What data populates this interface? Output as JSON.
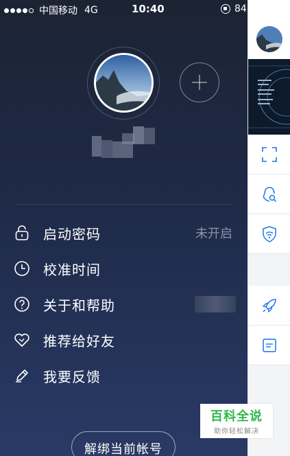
{
  "status_bar": {
    "carrier": "中国移动",
    "network": "4G",
    "time": "10:40",
    "battery": "84",
    "signal_dots": 5,
    "signal_filled": 4
  },
  "profile": {
    "add_account_icon": "plus-icon"
  },
  "menu": {
    "items": [
      {
        "label": "启动密码",
        "value": "未开启",
        "icon": "lock-icon"
      },
      {
        "label": "校准时间",
        "icon": "clock-icon"
      },
      {
        "label": "关于和帮助",
        "icon": "question-icon"
      },
      {
        "label": "推荐给好友",
        "icon": "heart-icon"
      },
      {
        "label": "我要反馈",
        "icon": "pencil-icon"
      }
    ]
  },
  "unbind_button": "解绑当前帐号",
  "right_panel": {
    "icons": [
      "scan-icon",
      "qq-search-icon",
      "shield-icon",
      "rocket-icon",
      "message-icon"
    ],
    "accent": "#1a73e8"
  },
  "watermark": {
    "title": "百科全说",
    "subtitle": "助你轻松解决"
  },
  "colors": {
    "drawer_top": "#1c2333",
    "drawer_bottom": "#2a3a66",
    "watermark_green": "#2fb84b"
  }
}
